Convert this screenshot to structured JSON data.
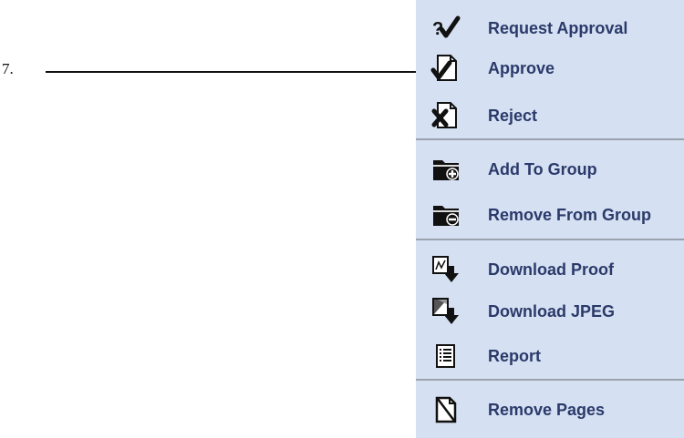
{
  "callout": {
    "label": "7."
  },
  "menu": {
    "items": [
      {
        "label": "Request Approval",
        "icon": "question-check-icon"
      },
      {
        "label": "Approve",
        "icon": "approve-document-icon"
      },
      {
        "label": "Reject",
        "icon": "reject-document-icon"
      },
      {
        "label": "Add To Group",
        "icon": "folder-add-icon"
      },
      {
        "label": "Remove From Group",
        "icon": "folder-remove-icon"
      },
      {
        "label": "Download Proof",
        "icon": "download-proof-icon"
      },
      {
        "label": "Download JPEG",
        "icon": "download-jpeg-icon"
      },
      {
        "label": "Report",
        "icon": "report-icon"
      },
      {
        "label": "Remove Pages",
        "icon": "remove-pages-icon"
      }
    ]
  },
  "colors": {
    "menu_bg": "#d5e0f2",
    "label": "#2b3a6a",
    "separator": "#9aa2ad"
  }
}
